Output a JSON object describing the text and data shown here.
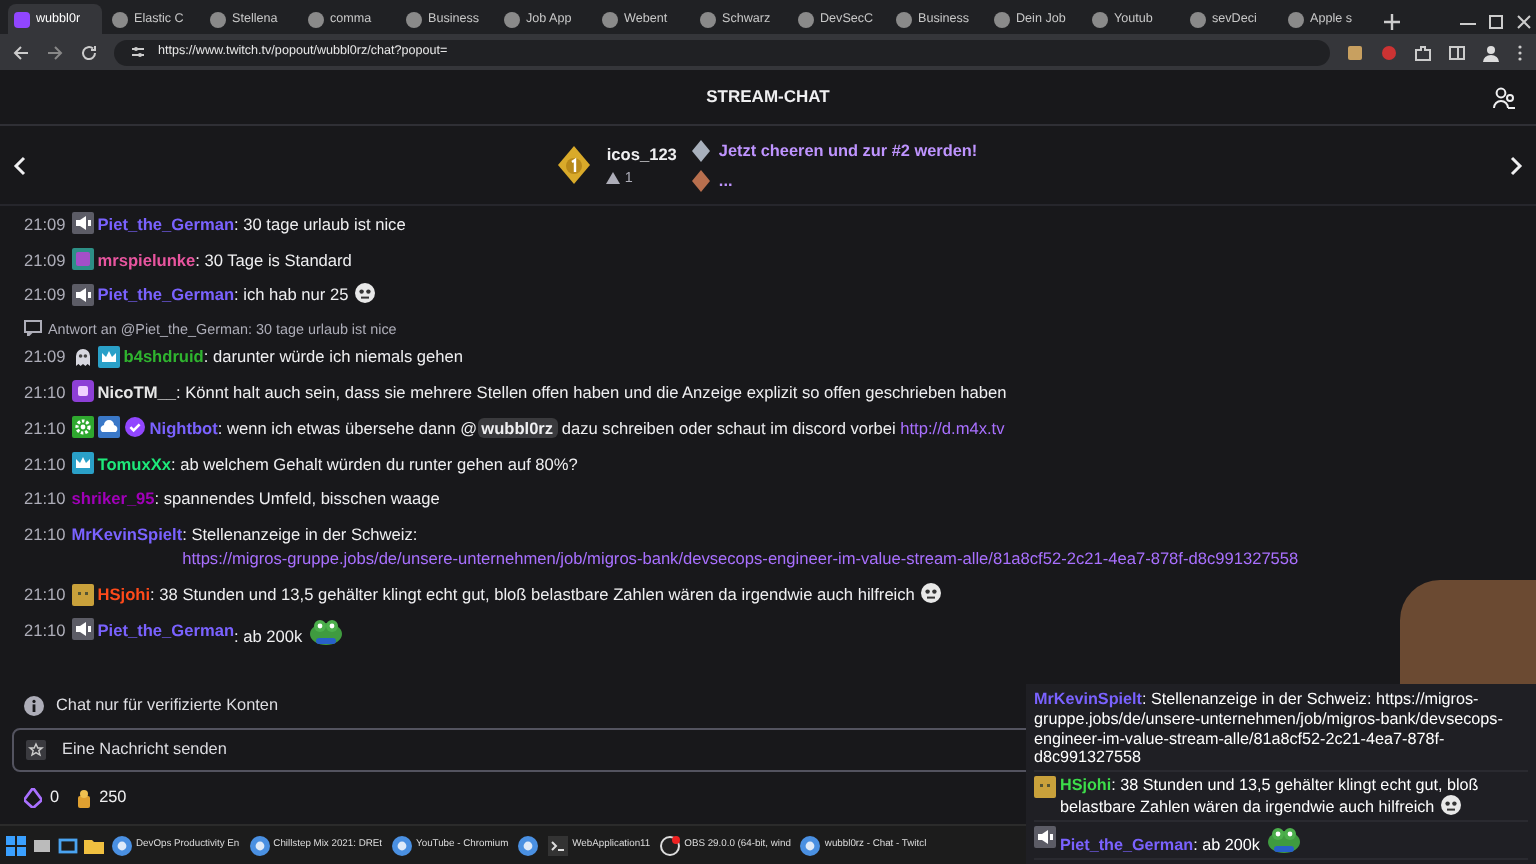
{
  "browser": {
    "tabs": [
      {
        "label": "wubbl0r",
        "selected": true
      },
      {
        "label": "Elastic C",
        "selected": false
      },
      {
        "label": "Stellena",
        "selected": false
      },
      {
        "label": "comma",
        "selected": false
      },
      {
        "label": "Business",
        "selected": false
      },
      {
        "label": "Job App",
        "selected": false
      },
      {
        "label": "Webent",
        "selected": false
      },
      {
        "label": "Schwarz",
        "selected": false
      },
      {
        "label": "DevSecC",
        "selected": false
      },
      {
        "label": "Business",
        "selected": false
      },
      {
        "label": "Dein Job",
        "selected": false
      },
      {
        "label": "Youtub",
        "selected": false
      },
      {
        "label": "sevDeci",
        "selected": false
      },
      {
        "label": "Apple s",
        "selected": false
      }
    ],
    "url": "https://www.twitch.tv/popout/wubbl0rz/chat?popout="
  },
  "chat_header": {
    "title": "STREAM-CHAT"
  },
  "leaderboard": {
    "user": "icos_123",
    "rank_change": "1",
    "cheer_text": "Jetzt cheeren und zur #2 werden!",
    "next": "..."
  },
  "messages": [
    {
      "kind": "message",
      "time": "21:09",
      "badges": [
        {
          "kind": "speaker"
        }
      ],
      "user": "Piet_the_German",
      "color": "#7a62ff",
      "parts": [
        {
          "kind": "text",
          "text": ": 30 tage urlaub ist nice"
        }
      ]
    },
    {
      "kind": "message",
      "time": "21:09",
      "badges": [
        {
          "kind": "sub"
        }
      ],
      "user": "mrspielunke",
      "color": "#e8559f",
      "parts": [
        {
          "kind": "text",
          "text": ": 30 Tage is Standard"
        }
      ]
    },
    {
      "kind": "message",
      "time": "21:09",
      "badges": [
        {
          "kind": "speaker"
        }
      ],
      "user": "Piet_the_German",
      "color": "#7a62ff",
      "parts": [
        {
          "kind": "text",
          "text": ": ich hab nur 25"
        },
        {
          "kind": "face"
        }
      ]
    },
    {
      "kind": "reply",
      "text": "Antwort an @Piet_the_German: 30 tage urlaub ist nice"
    },
    {
      "kind": "message",
      "time": "21:09",
      "badges": [
        {
          "kind": "ghost"
        },
        {
          "kind": "crown"
        }
      ],
      "user": "b4shdruid",
      "color": "#2fb42f",
      "parts": [
        {
          "kind": "text",
          "text": ": darunter würde ich niemals gehen"
        }
      ]
    },
    {
      "kind": "message",
      "time": "21:10",
      "badges": [
        {
          "kind": "purple"
        }
      ],
      "user": "NicoTM__",
      "color": "#e6e6e6",
      "parts": [
        {
          "kind": "text",
          "text": ": Könnt halt auch sein, dass sie mehrere Stellen offen haben und die Anzeige explizit so offen geschrieben haben"
        }
      ]
    },
    {
      "kind": "message",
      "time": "21:10",
      "badges": [
        {
          "kind": "gear"
        },
        {
          "kind": "cloud"
        },
        {
          "kind": "verified"
        }
      ],
      "user": "Nightbot",
      "color": "#7a62ff",
      "parts": [
        {
          "kind": "text",
          "text": ": wenn ich etwas übersehe dann @"
        },
        {
          "kind": "mention",
          "text": "wubbl0rz"
        },
        {
          "kind": "text",
          "text": " dazu schreiben oder schaut im discord vorbei "
        },
        {
          "kind": "link",
          "text": "http://d.m4x.tv"
        }
      ]
    },
    {
      "kind": "message",
      "time": "21:10",
      "badges": [
        {
          "kind": "crown"
        }
      ],
      "user": "TomuxXx",
      "color": "#1ee87a",
      "parts": [
        {
          "kind": "text",
          "text": ": ab welchem Gehalt würden du runter gehen auf 80%?"
        }
      ]
    },
    {
      "kind": "message",
      "time": "21:10",
      "user": "shriker_95",
      "color": "#a000b8",
      "parts": [
        {
          "kind": "text",
          "text": ": spannendes Umfeld, bisschen waage"
        }
      ]
    },
    {
      "kind": "message",
      "time": "21:10",
      "user": "MrKevinSpielt",
      "color": "#7a62ff",
      "parts": [
        {
          "kind": "text",
          "text": ": Stellenanzeige in der Schweiz: "
        },
        {
          "kind": "link",
          "text": "https://migros-gruppe.jobs/de/unsere-unternehmen/job/migros-bank/devsecops-engineer-im-value-stream-alle/81a8cf52-2c21-4ea7-878f-d8c991327558"
        }
      ]
    },
    {
      "kind": "message",
      "time": "21:10",
      "badges": [
        {
          "kind": "gold"
        }
      ],
      "user": "HSjohi",
      "color": "#ff4a1a",
      "parts": [
        {
          "kind": "text",
          "text": ": 38 Stunden und 13,5 gehälter klingt echt gut, bloß belastbare Zahlen wären da irgendwie auch hilfreich"
        },
        {
          "kind": "face"
        }
      ]
    },
    {
      "kind": "message",
      "time": "21:10",
      "badges": [
        {
          "kind": "speaker"
        }
      ],
      "user": "Piet_the_German",
      "color": "#7a62ff",
      "parts": [
        {
          "kind": "text",
          "text": ": ab 200k"
        },
        {
          "kind": "frog"
        }
      ]
    }
  ],
  "chat_notice": "Chat nur für verifizierte Konten",
  "input": {
    "placeholder": "Eine Nachricht senden"
  },
  "points": {
    "bits": "0",
    "channel_points": "250"
  },
  "overlay": {
    "messages": [
      {
        "user": "MrKevinSpielt",
        "color": "#7a62ff",
        "text": ": Stellenanzeige in der Schweiz: https://migros-gruppe.jobs/de/unsere-unternehmen/job/migros-bank/devsecops-engineer-im-value-stream-alle/81a8cf52-2c21-4ea7-878f-d8c991327558"
      },
      {
        "badges": [
          {
            "kind": "gold"
          }
        ],
        "user": "HSjohi",
        "color": "#3ddc4a",
        "text": ": 38 Stunden und 13,5 gehälter klingt echt gut, bloß belastbare Zahlen wären da irgendwie auch hilfreich",
        "emotes": [
          {
            "kind": "face"
          }
        ]
      },
      {
        "badges": [
          {
            "kind": "speaker"
          }
        ],
        "user": "Piet_the_German",
        "color": "#7a62ff",
        "text": ": ab 200k",
        "emotes": [
          {
            "kind": "frog"
          }
        ]
      }
    ]
  },
  "taskbar": {
    "apps": [
      {
        "kind": "chrome",
        "label": "DevOps Productivity En"
      },
      {
        "kind": "chrome",
        "label": "Chillstep Mix 2021: DREt"
      },
      {
        "kind": "chrome",
        "label": "YouTube - Chromium"
      },
      {
        "kind": "chrome"
      },
      {
        "kind": "terminal",
        "label": "WebApplication11"
      },
      {
        "kind": "obs",
        "label": "OBS 29.0.0 (64-bit, wind"
      },
      {
        "kind": "chrome",
        "label": "wubbl0rz - Chat - Twitcl"
      }
    ]
  }
}
